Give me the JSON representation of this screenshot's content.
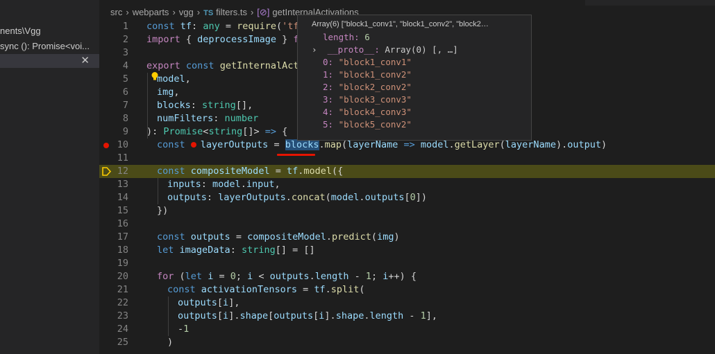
{
  "sidebar": {
    "rows": [
      "nents\\Vgg",
      "sync (): Promise<voi...",
      ""
    ]
  },
  "breadcrumb": {
    "parts": [
      "src",
      "webparts",
      "vgg",
      "filters.ts",
      "getInternalActivations"
    ],
    "file_icon": "TS",
    "symbol_icon": "[⊘]"
  },
  "hover": {
    "header": "Array(6) [\"block1_conv1\", \"block1_conv2\", \"block2…",
    "length_key": "length:",
    "length_val": "6",
    "proto_key": "__proto__:",
    "proto_val": "Array(0) [, …]",
    "items": [
      {
        "k": "0:",
        "v": "\"block1_conv1\""
      },
      {
        "k": "1:",
        "v": "\"block1_conv2\""
      },
      {
        "k": "2:",
        "v": "\"block2_conv2\""
      },
      {
        "k": "3:",
        "v": "\"block3_conv3\""
      },
      {
        "k": "4:",
        "v": "\"block4_conv3\""
      },
      {
        "k": "5:",
        "v": "\"block5_conv2\""
      }
    ]
  },
  "code": {
    "line_numbers": [
      "1",
      "2",
      "3",
      "4",
      "5",
      "6",
      "7",
      "8",
      "9",
      "10",
      "11",
      "12",
      "13",
      "14",
      "15",
      "16",
      "17",
      "18",
      "19",
      "20",
      "21",
      "22",
      "23",
      "24",
      "25"
    ],
    "l1": {
      "const": "const",
      "tf": "tf",
      "colon": ": ",
      "any": "any",
      "eq": " = ",
      "require": "require",
      "open": "(",
      "str": "'tf'"
    },
    "l2": {
      "import": "import",
      "brace": " { ",
      "name": "deprocessImage",
      "close": " } ",
      "from": "fr"
    },
    "l4": {
      "export": "export",
      "const": " const ",
      "fname": "getInternalActi"
    },
    "l5": {
      "model": "model",
      "comma": ","
    },
    "l6": {
      "img": "img",
      "comma": ","
    },
    "l7": {
      "blocks": "blocks",
      "colon": ": ",
      "type": "string",
      "rest": "[],"
    },
    "l8": {
      "numFilters": "numFilters",
      "colon": ": ",
      "type": "number"
    },
    "l9": {
      "paren": "): ",
      "promise": "Promise",
      "lt": "<",
      "type": "string",
      "rest": "[]> ",
      "arrow": "=>",
      "brace": " {"
    },
    "l10": {
      "const": "const",
      "name": "layerOutputs",
      "eq": " = ",
      "blocks": "blocks",
      "dot": ".",
      "map": "map",
      "open": "(",
      "p": "layerName",
      "arrow": " => ",
      "model": "model",
      "dot2": ".",
      "getLayer": "getLayer",
      "open2": "(",
      "arg": "layerName",
      "close2": ").",
      "output": "output",
      "close": ")"
    },
    "l12": {
      "const": "const",
      "name": "compositeModel",
      "eq": " = ",
      "tf": "tf",
      "dot": ".",
      "model": "model",
      "open": "({"
    },
    "l13": {
      "key": "inputs",
      "colon": ": ",
      "model": "model",
      "dot": ".",
      "input": "input",
      "comma": ","
    },
    "l14": {
      "key": "outputs",
      "colon": ": ",
      "lo": "layerOutputs",
      "dot": ".",
      "concat": "concat",
      "open": "(",
      "model": "model",
      "dot2": ".",
      "outputs": "outputs",
      "idx_open": "[",
      "zero": "0",
      "idx_close": "])"
    },
    "l15": {
      "text": "})"
    },
    "l17": {
      "const": "const",
      "name": "outputs",
      "eq": " = ",
      "cm": "compositeModel",
      "dot": ".",
      "predict": "predict",
      "open": "(",
      "img": "img",
      "close": ")"
    },
    "l18": {
      "let": "let",
      "name": "imageData",
      "colon": ": ",
      "type": "string",
      "rest": "[] = []"
    },
    "l20": {
      "for": "for",
      "open": " (",
      "let": "let",
      "i": "i",
      "eq": " = ",
      "zero": "0",
      "semi": "; ",
      "i2": "i",
      "lt": " < ",
      "outputs": "outputs",
      "dot": ".",
      "length": "length",
      "minus": " - ",
      "one": "1",
      "semi2": "; ",
      "i3": "i",
      "inc": "++) {"
    },
    "l21": {
      "const": "const",
      "name": "activationTensors",
      "eq": " = ",
      "tf": "tf",
      "dot": ".",
      "split": "split",
      "open": "("
    },
    "l22": {
      "outputs": "outputs",
      "idx": "[",
      "i": "i",
      "rest": "],"
    },
    "l23": {
      "outputs": "outputs",
      "idx": "[",
      "i": "i",
      "dot": "].",
      "shape": "shape",
      "open": "[",
      "outputs2": "outputs",
      "idx2": "[",
      "i2": "i",
      "dot2": "].",
      "shape2": "shape",
      "dot3": ".",
      "length": "length",
      "minus": " - ",
      "one": "1",
      "rest": "],"
    },
    "l24": {
      "minus": "-",
      "one": "1"
    },
    "l25": {
      "text": ")"
    }
  }
}
